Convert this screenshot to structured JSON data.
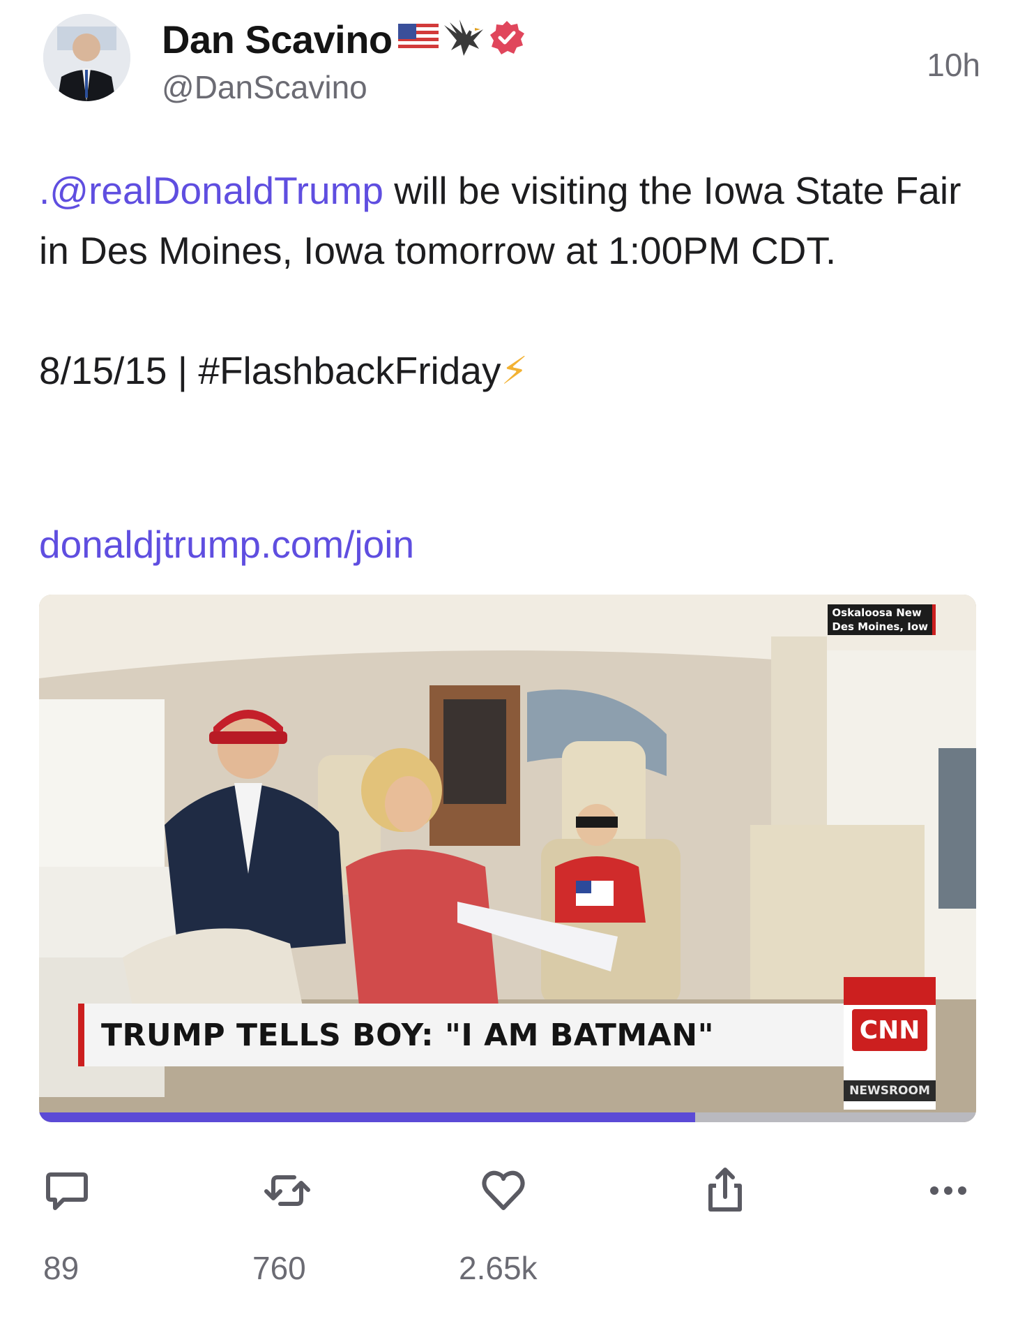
{
  "author": {
    "display_name": "Dan Scavino",
    "handle": "@DanScavino",
    "verified": true,
    "badge_icons": [
      "us-flag-icon",
      "eagle-icon",
      "verified-badge-icon"
    ]
  },
  "post": {
    "timestamp": "10h",
    "mention": ".@realDonaldTrump",
    "text_after_mention": " will be visiting the Iowa State Fair in Des Moines, Iowa tomorrow at 1:00PM CDT.",
    "date_line": "8/15/15",
    "separator": "|",
    "hashtag": "#FlashbackFriday",
    "hashtag_emoji": "⚡",
    "link": "donaldjtrump.com/join"
  },
  "media": {
    "type": "video",
    "headline": "TRUMP TELLS BOY: \"I AM BATMAN\"",
    "network_logo": "CNN",
    "network_sub": "NEWSROOM",
    "source_tag_line1": "Oskaloosa New",
    "source_tag_line2": "Des Moines, Iow",
    "progress": 0.7
  },
  "actions": {
    "reply_count": "89",
    "repost_count": "760",
    "like_count": "2.65k"
  },
  "colors": {
    "link": "#5f4ee0",
    "verified": "#e0465c",
    "muted": "#6b6b73",
    "progress": "#5b4ad6",
    "cnn_red": "#cc1f1f"
  }
}
